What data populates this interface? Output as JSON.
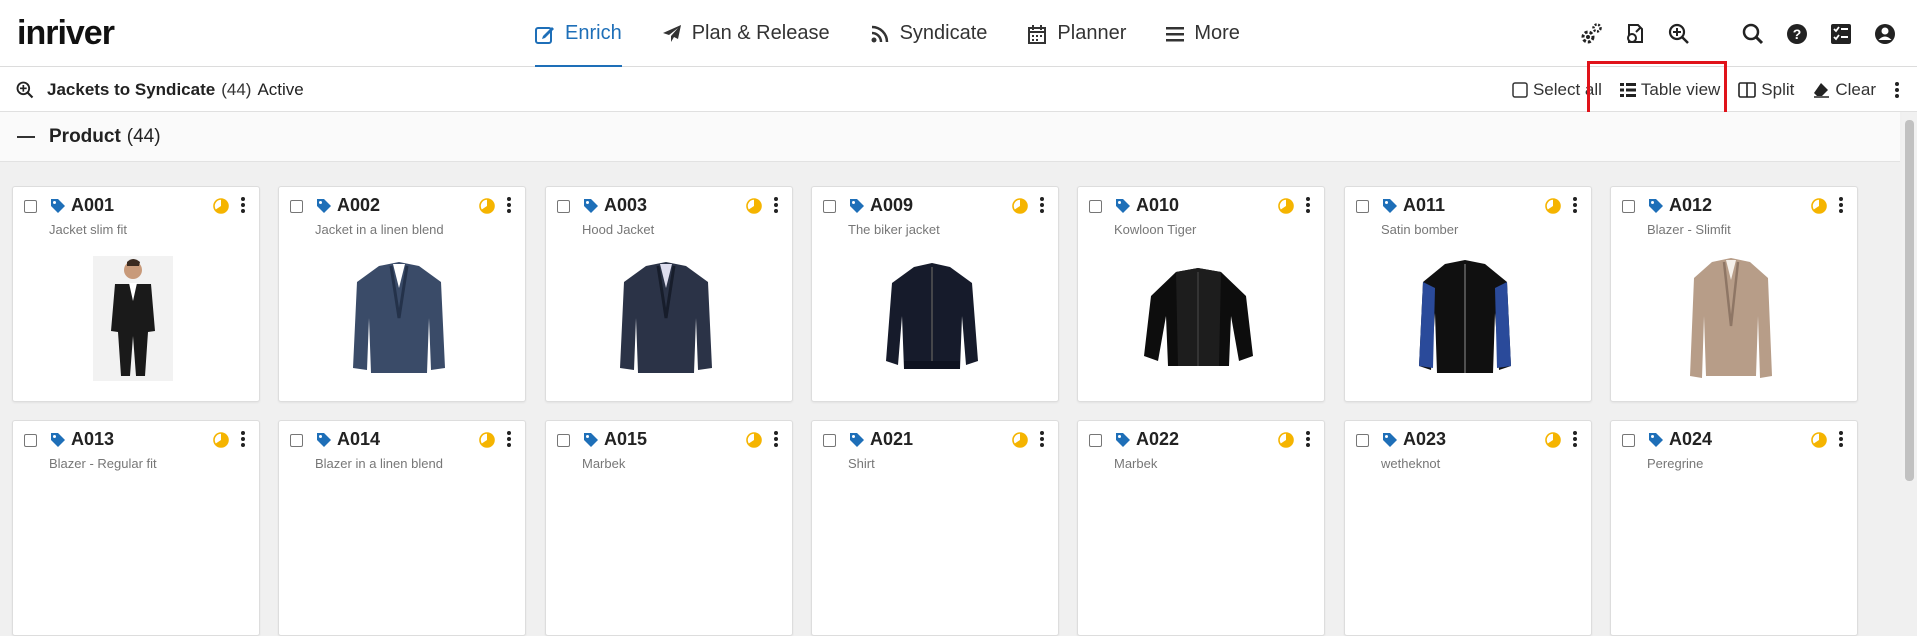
{
  "app": {
    "logo": "inriver"
  },
  "nav": [
    {
      "label": "Enrich",
      "icon": "edit-icon",
      "active": true
    },
    {
      "label": "Plan & Release",
      "icon": "paper-plane-icon",
      "active": false
    },
    {
      "label": "Syndicate",
      "icon": "feed-icon",
      "active": false
    },
    {
      "label": "Planner",
      "icon": "calendar-icon",
      "active": false
    },
    {
      "label": "More",
      "icon": "menu-icon",
      "active": false
    }
  ],
  "top_icons": [
    "settings-gears-icon",
    "file-export-icon",
    "search-plus-icon",
    "search-icon",
    "help-icon",
    "tasks-icon",
    "user-icon"
  ],
  "query": {
    "name": "Jackets to Syndicate",
    "count": "(44)",
    "state": "Active"
  },
  "actions": {
    "select_all": "Select all",
    "table_view": "Table view",
    "split": "Split",
    "clear": "Clear"
  },
  "group": {
    "title": "Product",
    "count": "(44)"
  },
  "colors": {
    "accent": "#1e6fb8",
    "tag": "#1e6fb8",
    "status": "#f5b400",
    "highlight": "#e0131a"
  },
  "cards": [
    {
      "code": "A001",
      "desc": "Jacket slim fit",
      "image": "suit-person"
    },
    {
      "code": "A002",
      "desc": "Jacket in a linen blend",
      "image": "blazer-blue"
    },
    {
      "code": "A003",
      "desc": "Hood Jacket",
      "image": "blazer-navy"
    },
    {
      "code": "A009",
      "desc": "The biker jacket",
      "image": "bomber-navy"
    },
    {
      "code": "A010",
      "desc": "Kowloon Tiger",
      "image": "bomber-black"
    },
    {
      "code": "A011",
      "desc": "Satin bomber",
      "image": "bomber-blue-satin"
    },
    {
      "code": "A012",
      "desc": "Blazer - Slimfit",
      "image": "blazer-beige"
    },
    {
      "code": "A013",
      "desc": "Blazer - Regular fit",
      "image": ""
    },
    {
      "code": "A014",
      "desc": "Blazer in a linen blend",
      "image": ""
    },
    {
      "code": "A015",
      "desc": "Marbek",
      "image": ""
    },
    {
      "code": "A021",
      "desc": "Shirt",
      "image": ""
    },
    {
      "code": "A022",
      "desc": "Marbek",
      "image": ""
    },
    {
      "code": "A023",
      "desc": "wetheknot",
      "image": ""
    },
    {
      "code": "A024",
      "desc": "Peregrine",
      "image": ""
    }
  ]
}
